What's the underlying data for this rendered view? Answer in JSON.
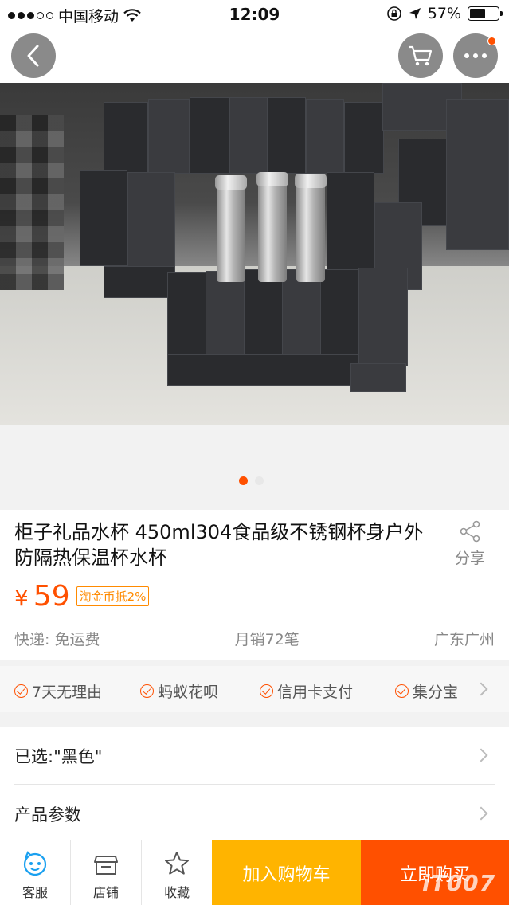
{
  "status_bar": {
    "carrier": "中国移动",
    "time": "12:09",
    "battery_percent": "57%",
    "battery_level": 0.57
  },
  "nav": {
    "back_icon": "chevron-left-icon",
    "cart_icon": "cart-icon",
    "more_icon": "more-dots-icon",
    "badge_color": "#ff5000"
  },
  "gallery": {
    "page_count": 2,
    "active_index": 0
  },
  "product": {
    "title": "柜子礼品水杯 450ml304食品级不锈钢杯身户外防隔热保温杯水杯",
    "share_label": "分享",
    "currency": "¥",
    "price": "59",
    "coin_badge": "淘金币抵2%",
    "shipping": "快递: 免运费",
    "monthly_sales": "月销72笔",
    "location": "广东广州"
  },
  "services": {
    "items": [
      "7天无理由",
      "蚂蚁花呗",
      "信用卡支付",
      "集分宝"
    ]
  },
  "options": {
    "selected": "已选:\"黑色\"",
    "params": "产品参数"
  },
  "bottom_bar": {
    "service": "客服",
    "shop": "店铺",
    "favorite": "收藏",
    "add_to_cart": "加入购物车",
    "buy_now": "立即购买"
  },
  "colors": {
    "accent": "#ff5000",
    "cart_button": "#ffb400",
    "service_icon": "#1aa0f0"
  },
  "watermark": "iT007"
}
